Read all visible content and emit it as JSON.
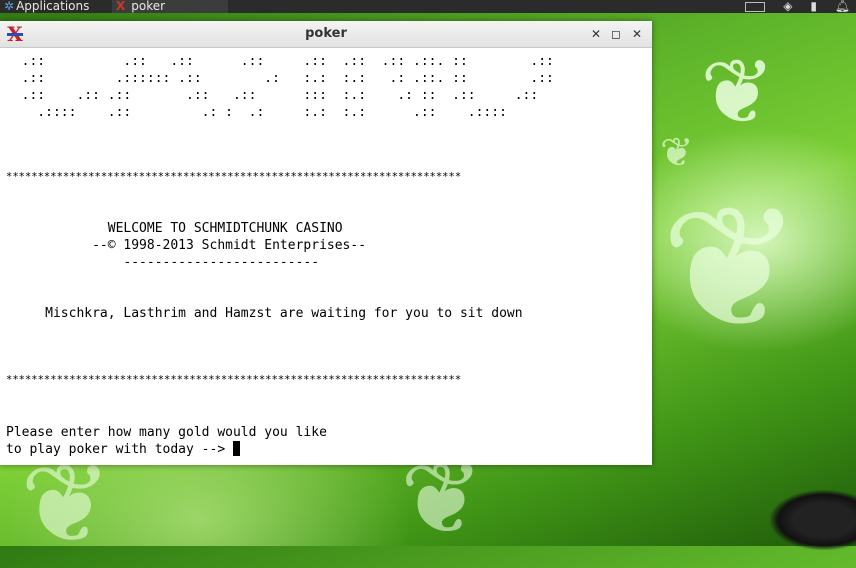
{
  "panel": {
    "applications_label": "Applications",
    "task_label": "poker"
  },
  "window": {
    "title": "poker"
  },
  "terminal": {
    "art_lines": [
      "  .::          .::   .::      .::     .::  .::  .:: .::. ::        .::",
      "  .::         .:::::: .::        .:   :.:  :.:   .: .::. ::        .::",
      "  .::    .:: .::       .::   .::      :::  :.:    .: ::  .::     .::",
      "    .::::    .::         .: :  .:     :.:  :.:      .::    .::::"
    ],
    "separator": "************************************************************************",
    "welcome_line": "             WELCOME TO SCHMIDTCHUNK CASINO",
    "copyright_line": "           --© 1998-2013 Schmidt Enterprises--",
    "underline_line": "               -------------------------",
    "waiting_line": "     Mischkra, Lasthrim and Hamzst are waiting for you to sit down",
    "prompt_line1": "Please enter how many gold would you like",
    "prompt_line2": "to play poker with today --> "
  }
}
